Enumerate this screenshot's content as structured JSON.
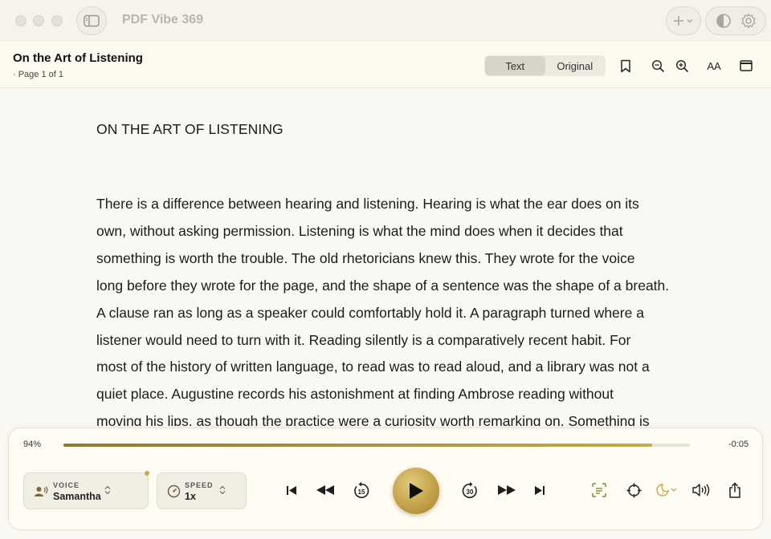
{
  "app": {
    "title": "PDF Vibe 369"
  },
  "document": {
    "title": "On the Art of Listening",
    "page_info": "· Page 1 of 1",
    "view_modes": [
      {
        "label": "Text",
        "active": true
      },
      {
        "label": "Original",
        "active": false
      }
    ],
    "text_size_label": "AA"
  },
  "content": {
    "heading": "ON THE ART OF LISTENING",
    "lines": [
      "There is a difference between hearing and listening. Hearing is what the ear does on its",
      "own, without asking permission. Listening is what the mind does when it decides that",
      "something is worth the trouble. The old rhetoricians knew this. They wrote for the voice",
      "long before they wrote for the page, and the shape of a sentence was the shape of a breath.",
      "A clause ran as long as a speaker could comfortably hold it. A paragraph turned where a",
      "listener would need to turn with it. Reading silently is a comparatively recent habit. For",
      "most of the history of written language, to read was to read aloud, and a library was not a",
      "quiet place. Augustine records his astonishment at finding Ambrose reading without",
      "moving his lips, as though the practice were a curiosity worth remarking on. Something is"
    ]
  },
  "player": {
    "progress_label": "94%",
    "progress": 0.94,
    "remaining": "-0:05",
    "voice": {
      "label": "VOICE",
      "value": "Samantha"
    },
    "speed": {
      "label": "SPEED",
      "value": "1x"
    },
    "skip_back_seconds": "15",
    "skip_forward_seconds": "30",
    "accent_color": "#c4a94d"
  },
  "icons": {
    "sidebar": "sidebar-icon",
    "add": "plus-icon",
    "appearance": "contrast-icon",
    "settings": "gear-icon",
    "bookmark": "bookmark-icon",
    "zoom_out": "zoom-out-icon",
    "zoom_in": "zoom-in-icon",
    "window": "window-icon"
  }
}
